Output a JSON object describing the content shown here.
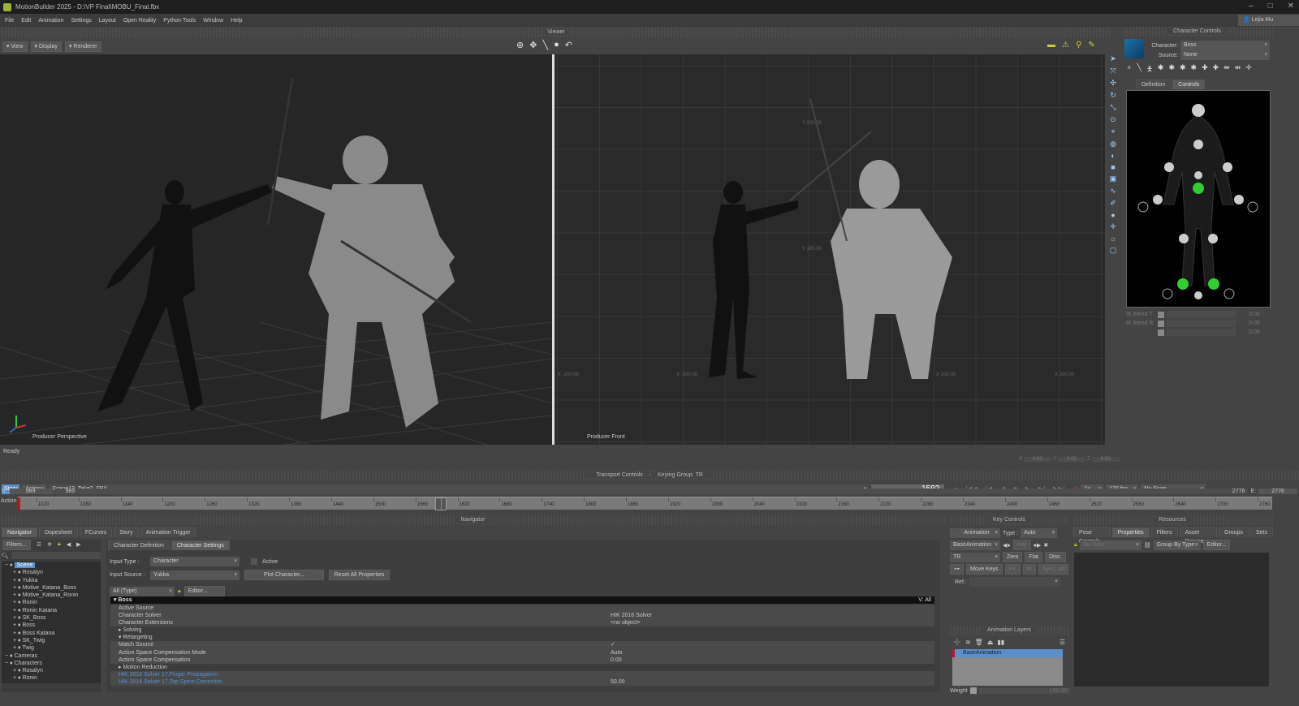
{
  "window": {
    "title": "MotionBuilder 2025 - D:\\VP Final\\MOBU_Final.fbx",
    "user": "Lejia Mu",
    "controls": [
      "minimize",
      "maximize",
      "close"
    ]
  },
  "menu": [
    "File",
    "Edit",
    "Animation",
    "Settings",
    "Layout",
    "Open Reality",
    "Python Tools",
    "Window",
    "Help"
  ],
  "viewer": {
    "title": "Viewer",
    "buttons": [
      "View",
      "Display",
      "Renderer"
    ],
    "left_label": "Producer Perspective",
    "right_label": "Producer Front",
    "front_grid_labels": [
      "Y 200.00",
      "Y 100.00",
      "X -200.00",
      "X -100.00",
      "X 100.00",
      "X 200.00"
    ],
    "status": "Ready",
    "coords": {
      "x_label": "X",
      "x": "0.00",
      "y_label": "Y",
      "y": "0.00",
      "z_label": "Z",
      "z": "0.00"
    }
  },
  "character_controls": {
    "title": "Character Controls",
    "character_label": "Character:",
    "character": "Boss",
    "source_label": "Source:",
    "source": "None",
    "tabs": [
      "Definition",
      "Controls"
    ],
    "active_tab": "Controls",
    "blends": [
      {
        "label": "IK Blend T",
        "value": "0.00"
      },
      {
        "label": "IK Blend R",
        "value": "0.00"
      },
      {
        "label": "",
        "value": "0.00"
      }
    ]
  },
  "transport": {
    "title": "Transport Controls",
    "keying_group": "Keying Group: TR",
    "mode_story": "Story",
    "mode_action": "Action",
    "take": "Scene13_Take2_FBX",
    "frame": "1592",
    "start_label": "S:",
    "start": "989",
    "start2": "989",
    "end": "2776",
    "end_label": "E:",
    "end2": "2776",
    "speed": "1x",
    "fps": "120 fps",
    "snap": "No Snap",
    "track_label": "Action",
    "ticks": [
      "1020",
      "1080",
      "1140",
      "1200",
      "1260",
      "1320",
      "1380",
      "1440",
      "1500",
      "1560",
      "1620",
      "1680",
      "1740",
      "1800",
      "1860",
      "1920",
      "1980",
      "2040",
      "2100",
      "2160",
      "2220",
      "2280",
      "2340",
      "2400",
      "2460",
      "2520",
      "2580",
      "2640",
      "2700",
      "2760"
    ],
    "range": [
      989,
      2776
    ],
    "current": 1592
  },
  "navigator": {
    "title": "Navigator",
    "tabs": [
      "Navigator",
      "Dopesheet",
      "FCurves",
      "Story",
      "Animation Trigger"
    ],
    "filters": "Filters...",
    "tree": [
      {
        "label": "Scene",
        "level": 0,
        "selected": true
      },
      {
        "label": "Rosalyn",
        "level": 1
      },
      {
        "label": "Yukka",
        "level": 1
      },
      {
        "label": "Motive_Katana_Boss",
        "level": 1
      },
      {
        "label": "Motive_Katana_Ronin",
        "level": 1
      },
      {
        "label": "Ronin",
        "level": 1
      },
      {
        "label": "Ronin Katana",
        "level": 1
      },
      {
        "label": "SK_Boss",
        "level": 1
      },
      {
        "label": "Boss",
        "level": 1
      },
      {
        "label": "Boss Katana",
        "level": 1
      },
      {
        "label": "SK_Twig",
        "level": 1
      },
      {
        "label": "Twig",
        "level": 1
      },
      {
        "label": "Cameras",
        "level": 0
      },
      {
        "label": "Characters",
        "level": 0
      },
      {
        "label": "Rosalyn",
        "level": 1
      },
      {
        "label": "Ronin",
        "level": 1
      },
      {
        "label": "Boss",
        "level": 1
      }
    ],
    "subtabs": [
      "Character Definition",
      "Character Settings"
    ],
    "input_type_label": "Input Type :",
    "input_type": "Character",
    "active_label": "Active",
    "input_source_label": "Input Source :",
    "input_source": "Yukka",
    "plot": "Plot Character...",
    "reset": "Reset All Properties",
    "filter": "All (Type)",
    "editor": "Editor...",
    "group": "Boss",
    "view_all": "V: All",
    "props": [
      {
        "label": "Active Source",
        "value": ""
      },
      {
        "label": "Character Solver",
        "value": "HIK 2016 Solver"
      },
      {
        "label": "Character Extensions",
        "value": "<no object>"
      },
      {
        "label": "▸ Solving",
        "value": ""
      },
      {
        "label": "▾ Retargeting",
        "value": ""
      },
      {
        "label": "Match Source",
        "value": "✓"
      },
      {
        "label": "Action Space Compensation Mode",
        "value": "Auto"
      },
      {
        "label": "Action Space Compensation",
        "value": "0.00"
      },
      {
        "label": "▸ Motion Reduction",
        "value": ""
      },
      {
        "label": "HIK 2016 Solver 17.Finger Propagation",
        "value": ""
      },
      {
        "label": "HIK 2016 Solver 17.Top Spine Correction",
        "value": "50.00"
      }
    ]
  },
  "key_controls": {
    "title": "Key Controls",
    "animation": "Animation",
    "type_label": "Type :",
    "type": "Auto",
    "layer": "BaseAnimation",
    "key": "Key",
    "filter": "TR",
    "zero": "Zero",
    "flat": "Flat",
    "disc": "Disc.",
    "move_keys": "Move Keys",
    "fk": "FK",
    "ik": "IK",
    "sync": "Sync. All",
    "ref": "Ref.:"
  },
  "animation_layers": {
    "title": "Animation Layers",
    "layers": [
      "BaseAnimation"
    ],
    "weight_label": "Weight",
    "weight": "100.00"
  },
  "resources": {
    "title": "Resources",
    "tabs": [
      "Pose Controls",
      "Properties",
      "Filters",
      "Asset Browser",
      "Groups",
      "Sets"
    ],
    "active_tab": "Properties",
    "view": "No View",
    "group_by": "Group By Type",
    "editor": "Editor..."
  }
}
